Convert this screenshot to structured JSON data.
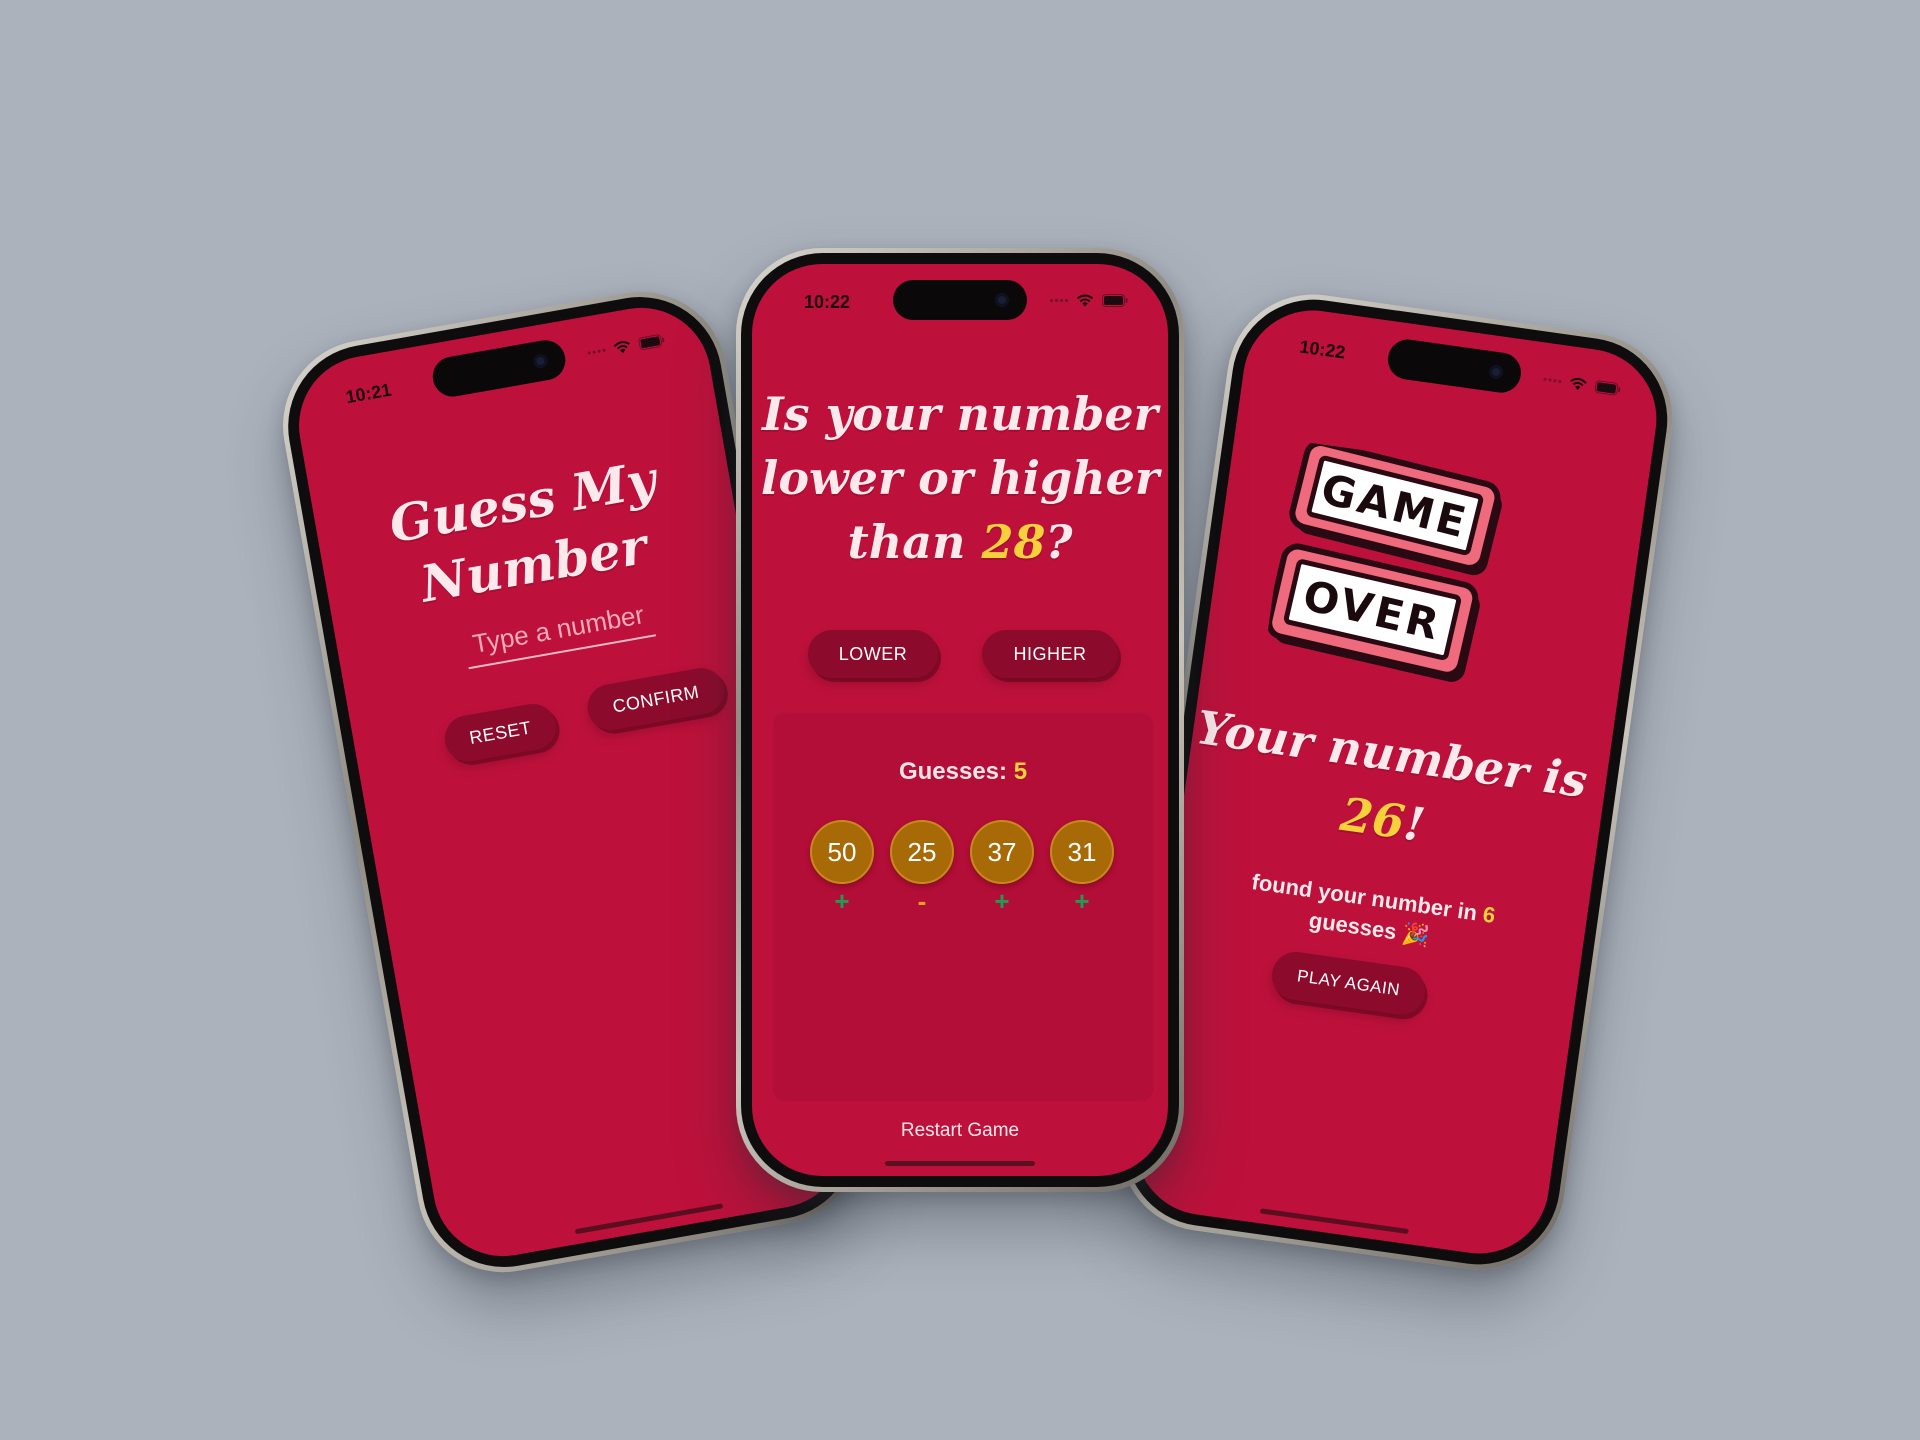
{
  "colors": {
    "background": "#abb2bc",
    "screen": "#bd113b",
    "panel": "#b30e37",
    "button": "#8c0b2d",
    "accent_yellow": "#f7d13c",
    "coin": "#a86a07",
    "plus": "#1c9d52",
    "minus": "#e0a414"
  },
  "left_phone": {
    "time": "10:21",
    "title_line1": "Guess My",
    "title_line2": "Number",
    "input_placeholder": "Type a number",
    "reset_label": "RESET",
    "confirm_label": "CONFIRM"
  },
  "center_phone": {
    "time": "10:22",
    "question_line1": "Is your number",
    "question_line2": "lower or higher",
    "question_prefix": "than ",
    "current_guess": "28",
    "question_suffix": "?",
    "lower_label": "LOWER",
    "higher_label": "HIGHER",
    "guesses_label": "Guesses: ",
    "guesses_count": "5",
    "guesses": [
      {
        "value": "50",
        "sign": "+"
      },
      {
        "value": "25",
        "sign": "-"
      },
      {
        "value": "37",
        "sign": "+"
      },
      {
        "value": "31",
        "sign": "+"
      }
    ],
    "restart_label": "Restart Game"
  },
  "right_phone": {
    "time": "10:22",
    "art_word1": "GAME",
    "art_word2": "OVER",
    "result_line1": "Your number is",
    "result_number": "26",
    "result_suffix": "!",
    "found_prefix": "found your number in ",
    "found_count": "6",
    "found_suffix": "guesses 🎉",
    "play_again_label": "PLAY AGAIN"
  }
}
